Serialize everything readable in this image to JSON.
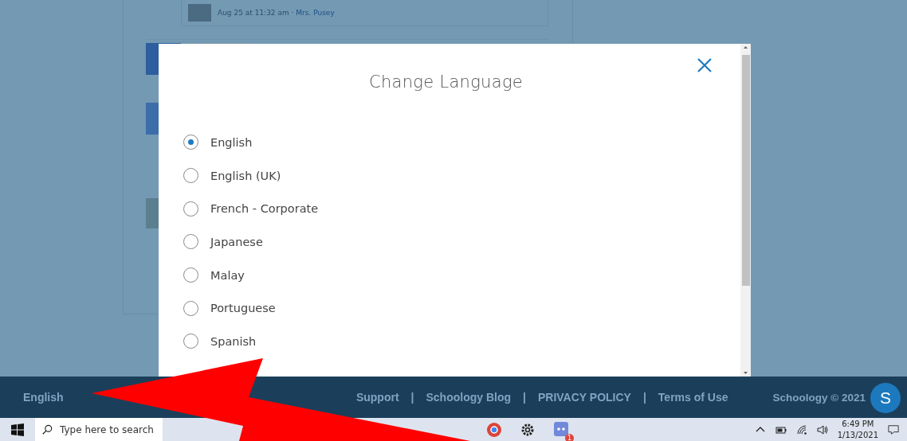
{
  "background": {
    "comment_meta": "Aug 25 at 11:32 am · ",
    "comment_author": "Mrs. Pusey"
  },
  "modal": {
    "title": "Change Language",
    "options": [
      {
        "label": "English",
        "selected": true
      },
      {
        "label": "English (UK)",
        "selected": false
      },
      {
        "label": "French - Corporate",
        "selected": false
      },
      {
        "label": "Japanese",
        "selected": false
      },
      {
        "label": "Malay",
        "selected": false
      },
      {
        "label": "Portuguese",
        "selected": false
      },
      {
        "label": "Spanish",
        "selected": false
      }
    ]
  },
  "footer": {
    "language": "English",
    "links": [
      "Support",
      "Schoology Blog",
      "PRIVACY POLICY",
      "Terms of Use"
    ],
    "separator": "|",
    "copyright": "Schoology © 2021",
    "badge": "S"
  },
  "taskbar": {
    "search": {
      "placeholder": "Type here to search"
    },
    "app_badge": "1",
    "time": "6:49 PM",
    "date": "1/13/2021"
  }
}
